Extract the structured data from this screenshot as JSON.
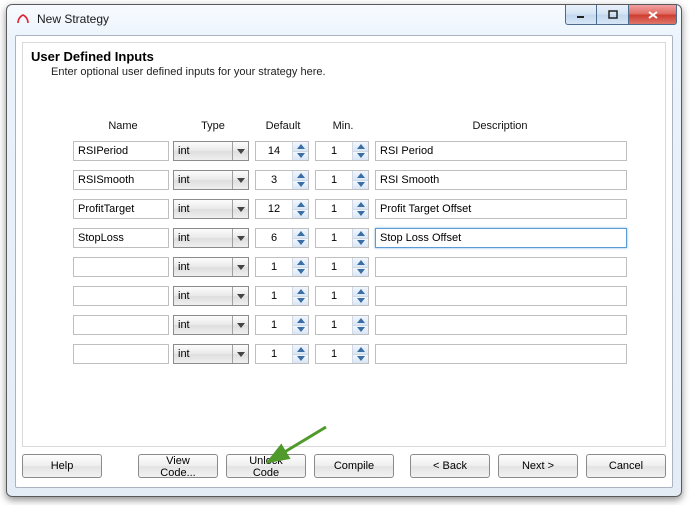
{
  "window": {
    "title": "New Strategy"
  },
  "heading": "User Defined Inputs",
  "subheading": "Enter optional user defined inputs for your strategy here.",
  "columns": {
    "name": "Name",
    "type": "Type",
    "def": "Default",
    "min": "Min.",
    "desc": "Description"
  },
  "rows": [
    {
      "name": "RSIPeriod",
      "type": "int",
      "default": "14",
      "min": "1",
      "desc": "RSI Period",
      "active": false
    },
    {
      "name": "RSISmooth",
      "type": "int",
      "default": "3",
      "min": "1",
      "desc": "RSI Smooth",
      "active": false
    },
    {
      "name": "ProfitTarget",
      "type": "int",
      "default": "12",
      "min": "1",
      "desc": "Profit Target Offset",
      "active": false
    },
    {
      "name": "StopLoss",
      "type": "int",
      "default": "6",
      "min": "1",
      "desc": "Stop Loss Offset",
      "active": true
    },
    {
      "name": "",
      "type": "int",
      "default": "1",
      "min": "1",
      "desc": "",
      "active": false
    },
    {
      "name": "",
      "type": "int",
      "default": "1",
      "min": "1",
      "desc": "",
      "active": false
    },
    {
      "name": "",
      "type": "int",
      "default": "1",
      "min": "1",
      "desc": "",
      "active": false
    },
    {
      "name": "",
      "type": "int",
      "default": "1",
      "min": "1",
      "desc": "",
      "active": false
    }
  ],
  "buttons": {
    "help": "Help",
    "view_code": "View Code...",
    "unlock_code": "Unlock Code",
    "compile": "Compile",
    "back": "< Back",
    "next": "Next >",
    "cancel": "Cancel"
  },
  "arrow_color": "#4f9a2a"
}
